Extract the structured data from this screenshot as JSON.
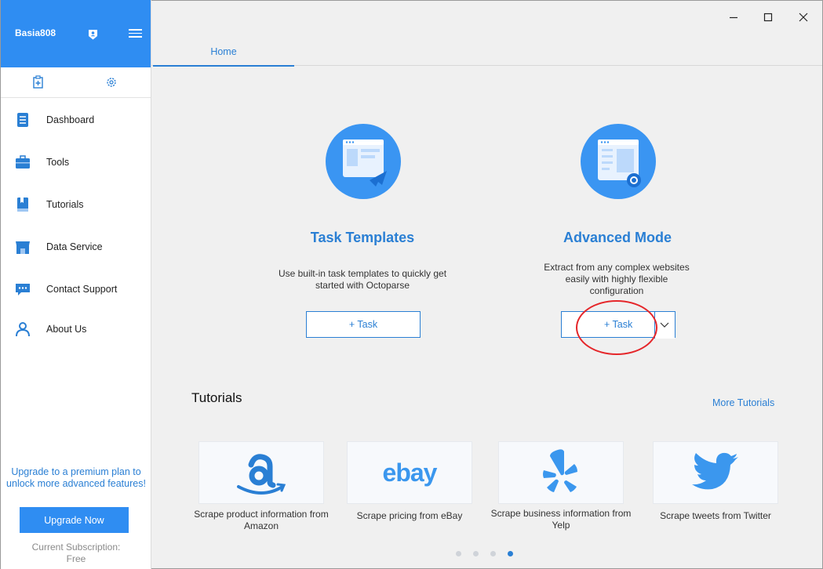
{
  "sidebar": {
    "username": "Basia808",
    "items": [
      {
        "label": "Dashboard",
        "icon": "dashboard-icon"
      },
      {
        "label": "Tools",
        "icon": "toolbox-icon"
      },
      {
        "label": "Tutorials",
        "icon": "book-icon"
      },
      {
        "label": "Data Service",
        "icon": "store-icon"
      },
      {
        "label": "Contact Support",
        "icon": "chat-icon"
      },
      {
        "label": "About Us",
        "icon": "person-icon"
      }
    ],
    "upgrade_text": "Upgrade to a premium plan to unlock more advanced features!",
    "upgrade_button": "Upgrade Now",
    "subscription_label": "Current Subscription:",
    "subscription_value": "Free"
  },
  "tabs": {
    "home": "Home"
  },
  "cards": {
    "templates": {
      "title": "Task Templates",
      "desc": "Use built-in task templates to quickly get started with Octoparse",
      "button": "+ Task"
    },
    "advanced": {
      "title": "Advanced Mode",
      "desc": "Extract from any complex websites easily with highly flexible configuration",
      "button": "+ Task"
    }
  },
  "tutorials": {
    "title": "Tutorials",
    "more": "More Tutorials",
    "items": [
      {
        "caption": "Scrape product information from Amazon",
        "logo": "amazon-logo"
      },
      {
        "caption": "Scrape pricing from eBay",
        "logo": "ebay-logo",
        "logo_text": "ebay"
      },
      {
        "caption": "Scrape business information from Yelp",
        "logo": "yelp-logo"
      },
      {
        "caption": "Scrape tweets from Twitter",
        "logo": "twitter-logo"
      }
    ],
    "pages": 4,
    "active_page": 4
  },
  "colors": {
    "brand": "#2f8df2",
    "link": "#2a7fd4",
    "annotation": "#e5262a"
  }
}
